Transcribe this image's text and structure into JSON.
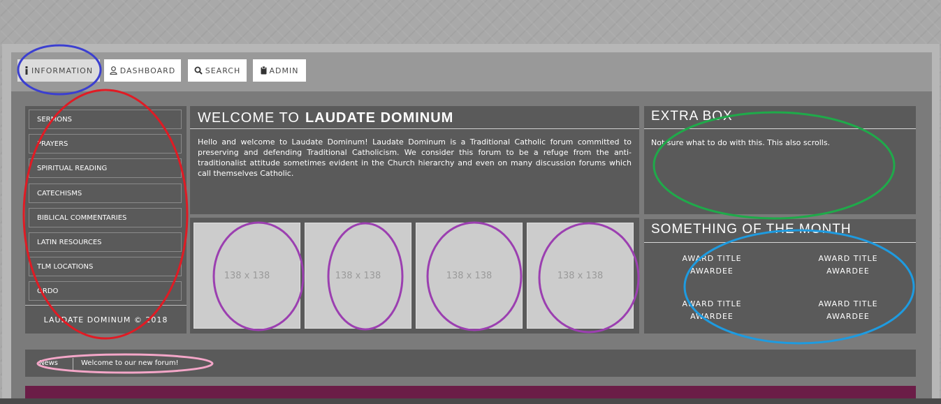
{
  "tabs": [
    {
      "label": "INFORMATION",
      "icon": "info-icon"
    },
    {
      "label": "DASHBOARD",
      "icon": "user-icon"
    },
    {
      "label": "SEARCH",
      "icon": "search-icon"
    },
    {
      "label": "ADMIN",
      "icon": "clipboard-icon"
    }
  ],
  "sidebar": {
    "items": [
      {
        "label": "SERMONS"
      },
      {
        "label": "PRAYERS"
      },
      {
        "label": "SPIRITUAL READING"
      },
      {
        "label": "CATECHISMS"
      },
      {
        "label": "BIBLICAL COMMENTARIES"
      },
      {
        "label": "LATIN RESOURCES"
      },
      {
        "label": "TLM LOCATIONS"
      },
      {
        "label": "ORDO"
      }
    ],
    "footer": "LAUDATE DOMINUM © 2018"
  },
  "welcome": {
    "title_prefix": "WELCOME TO",
    "title_bold": "LAUDATE DOMINUM",
    "body": "Hello and welcome to Laudate Dominum! Laudate Dominum is a Traditional Catholic forum committed to preserving and defending Traditional Catholicism. We consider this forum to be a refuge from the anti-traditionalist attitude sometimes evident in the Church hierarchy and even on many discussion forums which call themselves Catholic."
  },
  "gallery": {
    "placeholders": [
      "138 x 138",
      "138 x 138",
      "138 x 138",
      "138 x 138"
    ]
  },
  "extra_box": {
    "title": "EXTRA BOX",
    "text": "Not sure what to do with this. This also scrolls."
  },
  "month_box": {
    "title": "SOMETHING OF THE MONTH",
    "awards": [
      {
        "title": "AWARD TITLE",
        "awardee": "AWARDEE"
      },
      {
        "title": "AWARD TITLE",
        "awardee": "AWARDEE"
      },
      {
        "title": "AWARD TITLE",
        "awardee": "AWARDEE"
      },
      {
        "title": "AWARD TITLE",
        "awardee": "AWARDEE"
      }
    ]
  },
  "news": {
    "label": "News",
    "text": "Welcome to our new forum!"
  },
  "colors": {
    "panel": "#5a5a5a",
    "accent_purple": "#6b1d47",
    "highlight_blue": "#3b3fd0",
    "highlight_red": "#e01b24",
    "highlight_green": "#1faa4a",
    "highlight_violet": "#9b3fb0",
    "highlight_cyan": "#1e9be0",
    "highlight_pink": "#f4a6c8"
  }
}
